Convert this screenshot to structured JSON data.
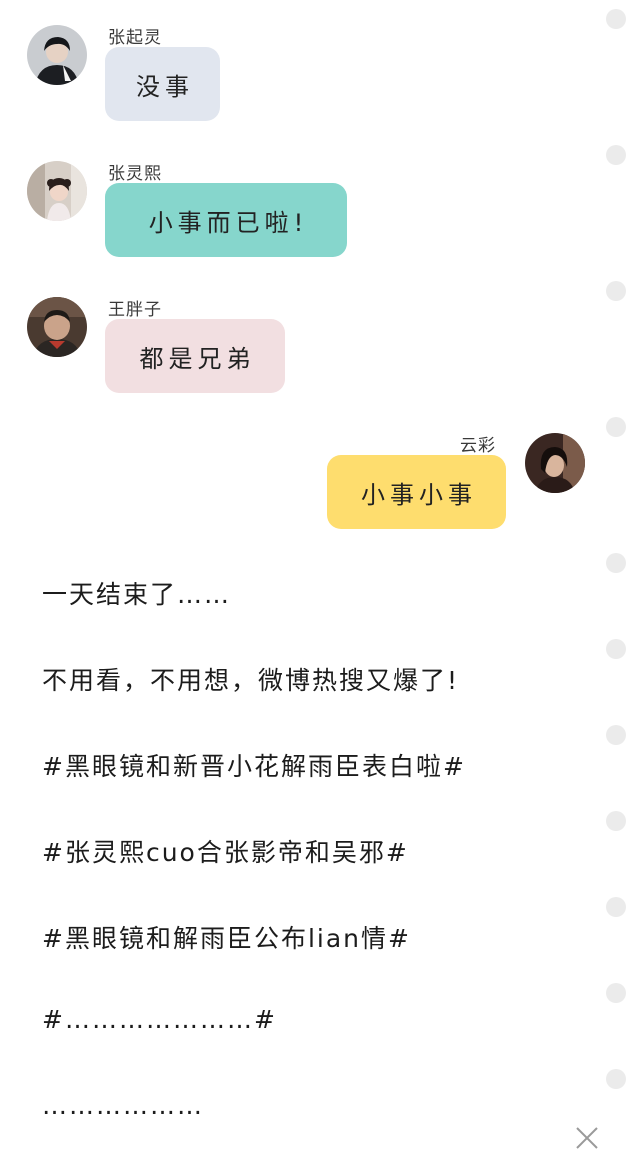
{
  "messages": [
    {
      "sender": "张起灵",
      "text": "没事",
      "side": "left",
      "bubble_color": "#e1e6ef",
      "avatar_icon": "avatar-zhang-qiling"
    },
    {
      "sender": "张灵熙",
      "text": "小事而已啦!",
      "side": "left",
      "bubble_color": "#86d6cc",
      "avatar_icon": "avatar-zhang-lingxi"
    },
    {
      "sender": "王胖子",
      "text": "都是兄弟",
      "side": "left",
      "bubble_color": "#f2dfe1",
      "avatar_icon": "avatar-wang-pangzi"
    },
    {
      "sender": "云彩",
      "text": "小事小事",
      "side": "right",
      "bubble_color": "#fedd6e",
      "avatar_icon": "avatar-yuncai"
    }
  ],
  "story": [
    "一天结束了……",
    "不用看，不用想，微博热搜又爆了!",
    "#黑眼镜和新晋小花解雨臣表白啦#",
    "#张灵熙cuo合张影帝和吴邪#",
    "#黑眼镜和解雨臣公布lian情#",
    "#…………………#",
    "………………"
  ],
  "controls": {
    "close_icon": "close-icon",
    "scroll_dot_count": 13
  }
}
